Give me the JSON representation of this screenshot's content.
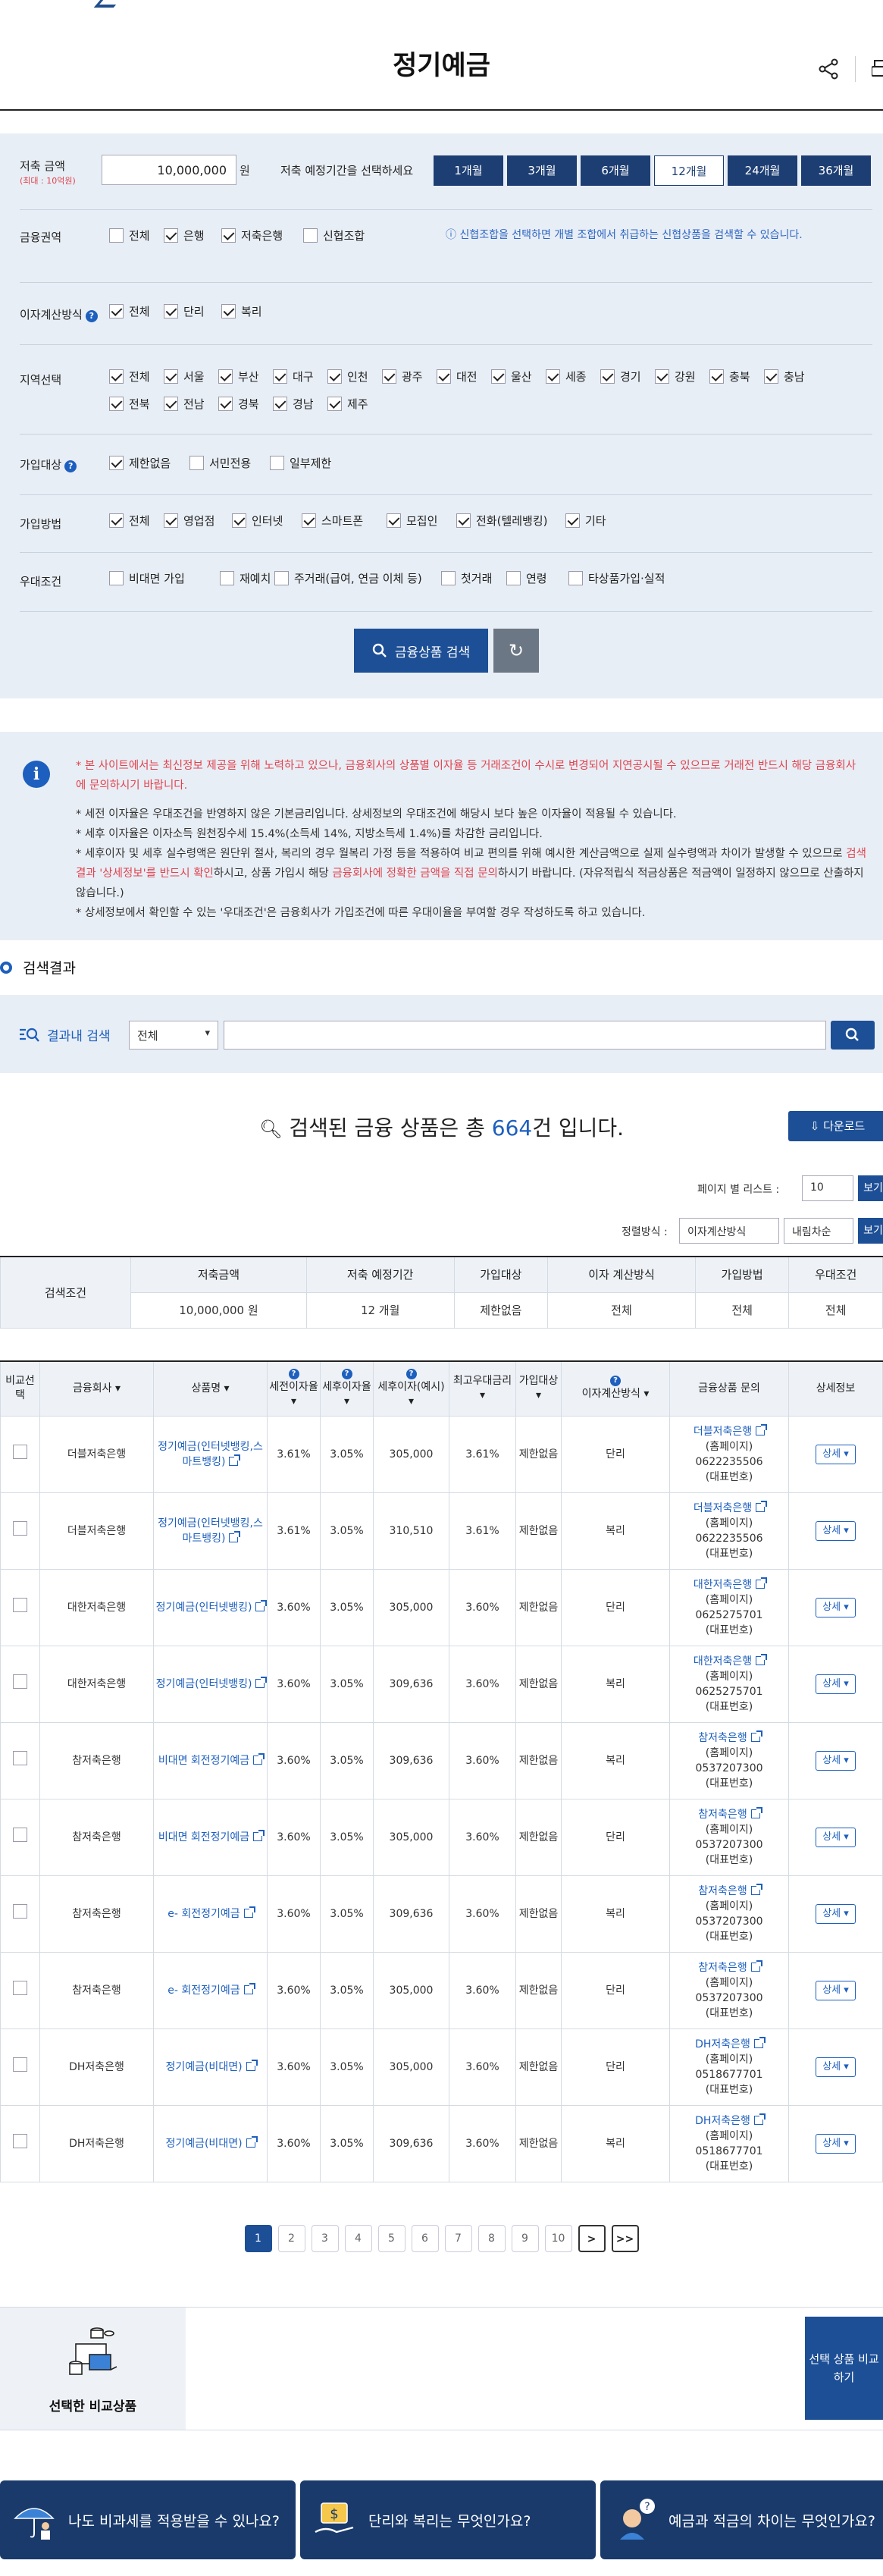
{
  "header": {
    "title": "정기예금"
  },
  "search": {
    "amount_label": "저축 금액",
    "amount_sub": "(최대 : 10억원)",
    "amount_value": "10,000,000",
    "amount_unit": "원",
    "period_label": "저축 예정기간을 선택하세요",
    "periods": [
      "1개월",
      "3개월",
      "6개월",
      "12개월",
      "24개월",
      "36개월"
    ],
    "sector_label": "금융권역",
    "sectors": [
      "전체",
      "은행",
      "저축은행",
      "신협조합"
    ],
    "sector_note": "신협조합을 선택하면 개별 조합에서 취급하는 신협상품을 검색할 수 있습니다.",
    "interest_label": "이자계산방식",
    "interest": [
      "전체",
      "단리",
      "복리"
    ],
    "region_label": "지역선택",
    "regions": [
      "전체",
      "서울",
      "부산",
      "대구",
      "인천",
      "광주",
      "대전",
      "울산",
      "세종",
      "경기",
      "강원",
      "충북",
      "충남",
      "전북",
      "전남",
      "경북",
      "경남",
      "제주"
    ],
    "target_label": "가입대상",
    "targets": [
      "제한없음",
      "서민전용",
      "일부제한"
    ],
    "method_label": "가입방법",
    "methods": [
      "전체",
      "영업점",
      "인터넷",
      "스마트폰",
      "모집인",
      "전화(텔레뱅킹)",
      "기타"
    ],
    "pref_label": "우대조건",
    "prefs": [
      "비대면 가입",
      "재예치",
      "주거래(급여, 연금 이체 등)",
      "첫거래",
      "연령",
      "타상품가입·실적"
    ],
    "search_button": "금융상품 검색"
  },
  "notice": {
    "warn": "* 본 사이트에서는 최신정보 제공을 위해 노력하고 있으나, 금융회사의 상품별 이자율 등 거래조건이 수시로 변경되어 지연공시될 수 있으므로 거래전 반드시 해당 금융회사에 문의하시기 바랍니다.",
    "n1": "* 세전 이자율은 우대조건을 반영하지 않은 기본금리입니다. 상세정보의 우대조건에 해당시 보다 높은 이자율이 적용될 수 있습니다.",
    "n2": "* 세후 이자율은 이자소득 원천징수세 15.4%(소득세 14%, 지방소득세 1.4%)를 차감한 금리입니다.",
    "n3a": "* 세후이자 및 세후 실수령액은 원단위 절사, 복리의 경우 월복리 가정 등을 적용하여 비교 편의를 위해 예시한 계산금액으로 실제 실수령액과 차이가 발생할 수 있으므로 ",
    "n3b": "검색결과 '상세정보'를 반드시 확인",
    "n3c": "하시고, 상품 가입시 해당 ",
    "n3d": "금융회사에 정확한 금액을 직접 문의",
    "n3e": "하시기 바랍니다. (자유적립식 적금상품은 적금액이 일정하지 않으므로 산출하지 않습니다.)",
    "n4": "* 상세정보에서 확인할 수 있는 '우대조건'은 금융회사가 가입조건에 따른 우대이율을 부여할 경우 작성하도록 하고 있습니다."
  },
  "results": {
    "title": "검색결과",
    "filter_label": "결과내 검색",
    "filter_select": "전체",
    "count_pre": "검색된 금융 상품은 총 ",
    "count": "664",
    "count_post": "건 입니다.",
    "download": "다운로드",
    "page_list_label": "페이지 별 리스트 :",
    "page_list_value": "10",
    "view": "보기",
    "sort_label": "정렬방식 :",
    "sort1": "이자계산방식",
    "sort2": "내림차순"
  },
  "cond": {
    "title": "검색조건",
    "headers": [
      "저축금액",
      "저축 예정기간",
      "가입대상",
      "이자 계산방식",
      "가입방법",
      "우대조건"
    ],
    "values": [
      "10,000,000 원",
      "12 개월",
      "제한없음",
      "전체",
      "전체",
      "전체"
    ]
  },
  "table": {
    "headers": {
      "compare": "비교선택",
      "company": "금융회사",
      "product": "상품명",
      "pre": "세전이자율",
      "post": "세후이자율",
      "after": "세후이자(예시)",
      "max": "최고우대금리",
      "target": "가입대상",
      "method": "이자계산방식",
      "contact": "금융상품 문의",
      "detail": "상세정보"
    },
    "rows": [
      {
        "company": "더블저축은행",
        "product": "정기예금(인터넷뱅킹,스마트뱅킹)",
        "pre": "3.61%",
        "post": "3.05%",
        "after": "305,000",
        "max": "3.61%",
        "target": "제한없음",
        "method": "단리",
        "cname": "더블저축은행",
        "phone": "0622235506"
      },
      {
        "company": "더블저축은행",
        "product": "정기예금(인터넷뱅킹,스마트뱅킹)",
        "pre": "3.61%",
        "post": "3.05%",
        "after": "310,510",
        "max": "3.61%",
        "target": "제한없음",
        "method": "복리",
        "cname": "더블저축은행",
        "phone": "0622235506"
      },
      {
        "company": "대한저축은행",
        "product": "정기예금(인터넷뱅킹)",
        "pre": "3.60%",
        "post": "3.05%",
        "after": "305,000",
        "max": "3.60%",
        "target": "제한없음",
        "method": "단리",
        "cname": "대한저축은행",
        "phone": "0625275701"
      },
      {
        "company": "대한저축은행",
        "product": "정기예금(인터넷뱅킹)",
        "pre": "3.60%",
        "post": "3.05%",
        "after": "309,636",
        "max": "3.60%",
        "target": "제한없음",
        "method": "복리",
        "cname": "대한저축은행",
        "phone": "0625275701"
      },
      {
        "company": "참저축은행",
        "product": "비대면 회전정기예금",
        "pre": "3.60%",
        "post": "3.05%",
        "after": "309,636",
        "max": "3.60%",
        "target": "제한없음",
        "method": "복리",
        "cname": "참저축은행",
        "phone": "0537207300"
      },
      {
        "company": "참저축은행",
        "product": "비대면 회전정기예금",
        "pre": "3.60%",
        "post": "3.05%",
        "after": "305,000",
        "max": "3.60%",
        "target": "제한없음",
        "method": "단리",
        "cname": "참저축은행",
        "phone": "0537207300"
      },
      {
        "company": "참저축은행",
        "product": "e- 회전정기예금",
        "pre": "3.60%",
        "post": "3.05%",
        "after": "309,636",
        "max": "3.60%",
        "target": "제한없음",
        "method": "복리",
        "cname": "참저축은행",
        "phone": "0537207300"
      },
      {
        "company": "참저축은행",
        "product": "e- 회전정기예금",
        "pre": "3.60%",
        "post": "3.05%",
        "after": "305,000",
        "max": "3.60%",
        "target": "제한없음",
        "method": "단리",
        "cname": "참저축은행",
        "phone": "0537207300"
      },
      {
        "company": "DH저축은행",
        "product": "정기예금(비대면)",
        "pre": "3.60%",
        "post": "3.05%",
        "after": "305,000",
        "max": "3.60%",
        "target": "제한없음",
        "method": "단리",
        "cname": "DH저축은행",
        "phone": "0518677701"
      },
      {
        "company": "DH저축은행",
        "product": "정기예금(비대면)",
        "pre": "3.60%",
        "post": "3.05%",
        "after": "309,636",
        "max": "3.60%",
        "target": "제한없음",
        "method": "복리",
        "cname": "DH저축은행",
        "phone": "0518677701"
      }
    ],
    "homepage": "(홈페이지)",
    "rep": "(대표번호)",
    "detail_btn": "상세 ▾"
  },
  "pager": {
    "pages": [
      "1",
      "2",
      "3",
      "4",
      "5",
      "6",
      "7",
      "8",
      "9",
      "10"
    ],
    "next": ">",
    "last": ">>"
  },
  "compare": {
    "title": "선택한 비교상품",
    "button": "선택 상품 비교하기"
  },
  "banners": [
    "나도 비과세를 적용받을 수 있나요?",
    "단리와 복리는 무엇인가요?",
    "예금과 적금의 차이는 무엇인가요?"
  ]
}
